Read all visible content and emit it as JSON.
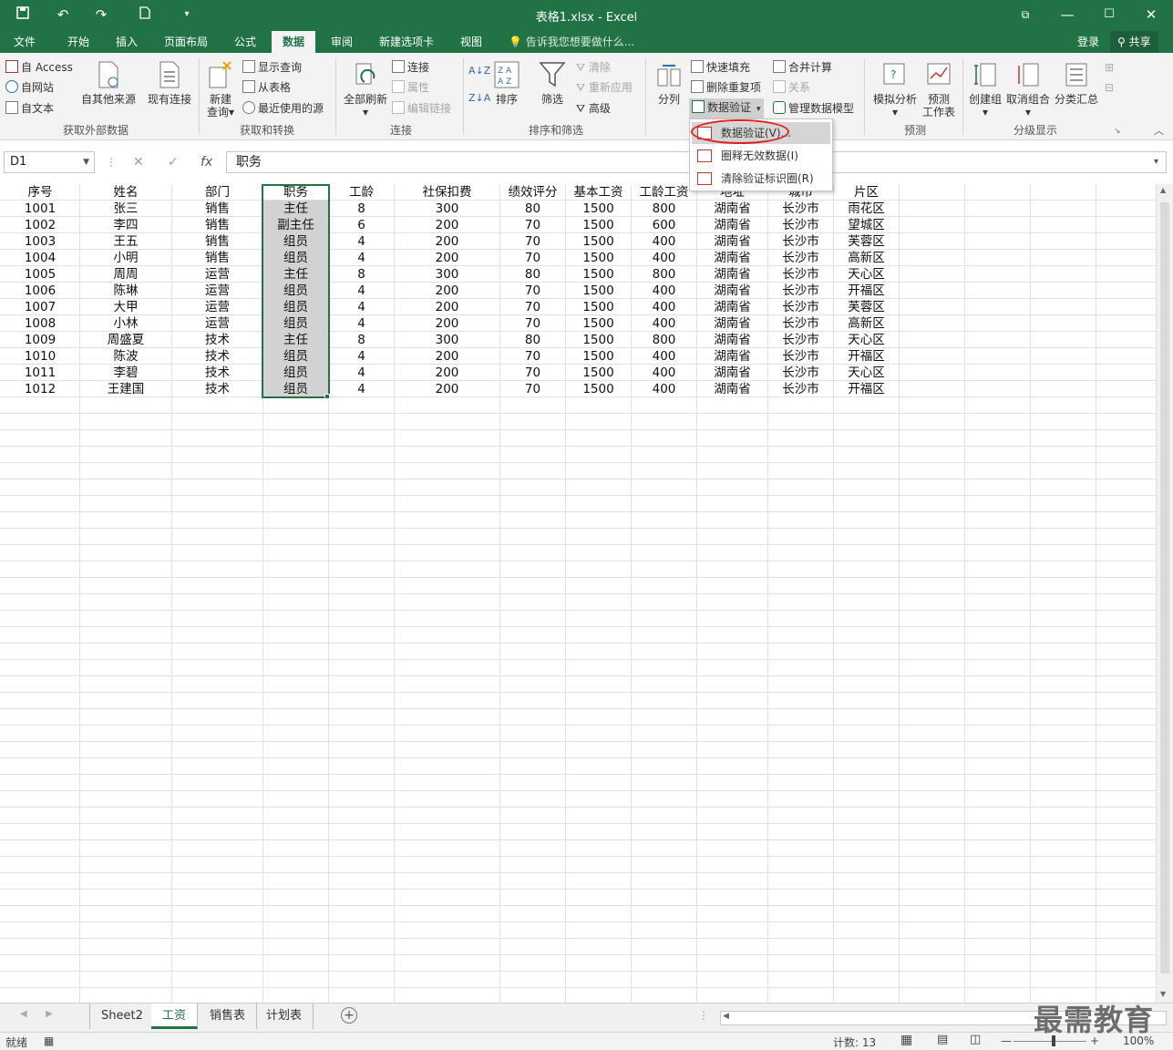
{
  "window": {
    "title": "表格1.xlsx - Excel",
    "qat": [
      "save-icon",
      "undo-icon",
      "redo-icon",
      "new-file-icon",
      "customize-qat-icon"
    ],
    "controls": [
      "ribbon-display-icon",
      "minimize-icon",
      "maximize-icon",
      "close-icon"
    ]
  },
  "tabs": [
    "文件",
    "开始",
    "插入",
    "页面布局",
    "公式",
    "数据",
    "审阅",
    "新建选项卡",
    "视图"
  ],
  "active_tab": "数据",
  "tell_me": "告诉我您想要做什么...",
  "signin": "登录",
  "share": "共享",
  "ribbon": {
    "get_external": {
      "group": "获取外部数据",
      "from_access": "自 Access",
      "from_web": "自网站",
      "from_text": "自文本",
      "from_other": "自其他来源",
      "existing": "现有连接"
    },
    "get_transform": {
      "group": "获取和转换",
      "new_query_1": "新建",
      "new_query_2": "查询",
      "show_queries": "显示查询",
      "from_table": "从表格",
      "recent_sources": "最近使用的源"
    },
    "connections": {
      "group": "连接",
      "refresh_all": "全部刷新",
      "connections": "连接",
      "properties": "属性",
      "edit_links": "编辑链接"
    },
    "sort_filter": {
      "group": "排序和筛选",
      "sort": "排序",
      "filter": "筛选",
      "clear": "清除",
      "reapply": "重新应用",
      "advanced": "高级"
    },
    "data_tools": {
      "split": "分列",
      "flash_fill": "快速填充",
      "remove_dup": "删除重复项",
      "validation": "数据验证",
      "consolidate": "合并计算",
      "relationships": "关系",
      "manage_model": "管理数据模型"
    },
    "forecast": {
      "group": "预测",
      "what_if": "模拟分析",
      "sheet_1": "预测",
      "sheet_2": "工作表"
    },
    "outline": {
      "group": "分级显示",
      "group_btn": "创建组",
      "ungroup": "取消组合",
      "subtotal": "分类汇总"
    }
  },
  "validation_menu": [
    {
      "label": "数据验证(V)..."
    },
    {
      "label": "圈释无效数据(I)"
    },
    {
      "label": "清除验证标识圈(R)"
    }
  ],
  "formula_bar": {
    "name_box": "D1",
    "cancel": "✕",
    "enter": "✓",
    "fx": "fx",
    "value": "职务"
  },
  "sheet": {
    "headers": [
      "序号",
      "姓名",
      "部门",
      "职务",
      "工龄",
      "社保扣费",
      "绩效评分",
      "基本工资",
      "工龄工资",
      "地址",
      "城市",
      "片区"
    ],
    "rows": [
      [
        "1001",
        "张三",
        "销售",
        "主任",
        "8",
        "300",
        "80",
        "1500",
        "800",
        "湖南省",
        "长沙市",
        "雨花区"
      ],
      [
        "1002",
        "李四",
        "销售",
        "副主任",
        "6",
        "200",
        "70",
        "1500",
        "600",
        "湖南省",
        "长沙市",
        "望城区"
      ],
      [
        "1003",
        "王五",
        "销售",
        "组员",
        "4",
        "200",
        "70",
        "1500",
        "400",
        "湖南省",
        "长沙市",
        "芙蓉区"
      ],
      [
        "1004",
        "小明",
        "销售",
        "组员",
        "4",
        "200",
        "70",
        "1500",
        "400",
        "湖南省",
        "长沙市",
        "高新区"
      ],
      [
        "1005",
        "周周",
        "运营",
        "主任",
        "8",
        "300",
        "80",
        "1500",
        "800",
        "湖南省",
        "长沙市",
        "天心区"
      ],
      [
        "1006",
        "陈琳",
        "运营",
        "组员",
        "4",
        "200",
        "70",
        "1500",
        "400",
        "湖南省",
        "长沙市",
        "开福区"
      ],
      [
        "1007",
        "大甲",
        "运营",
        "组员",
        "4",
        "200",
        "70",
        "1500",
        "400",
        "湖南省",
        "长沙市",
        "芙蓉区"
      ],
      [
        "1008",
        "小林",
        "运营",
        "组员",
        "4",
        "200",
        "70",
        "1500",
        "400",
        "湖南省",
        "长沙市",
        "高新区"
      ],
      [
        "1009",
        "周盛夏",
        "技术",
        "主任",
        "8",
        "300",
        "80",
        "1500",
        "800",
        "湖南省",
        "长沙市",
        "天心区"
      ],
      [
        "1010",
        "陈波",
        "技术",
        "组员",
        "4",
        "200",
        "70",
        "1500",
        "400",
        "湖南省",
        "长沙市",
        "开福区"
      ],
      [
        "1011",
        "李碧",
        "技术",
        "组员",
        "4",
        "200",
        "70",
        "1500",
        "400",
        "湖南省",
        "长沙市",
        "天心区"
      ],
      [
        "1012",
        "王建国",
        "技术",
        "组员",
        "4",
        "200",
        "70",
        "1500",
        "400",
        "湖南省",
        "长沙市",
        "开福区"
      ]
    ]
  },
  "sheet_tabs": [
    "Sheet2",
    "工资",
    "销售表",
    "计划表"
  ],
  "active_sheet": "工资",
  "status": {
    "ready": "就绪",
    "count": "计数: 13",
    "zoom": "100%"
  },
  "watermark": "最需教育",
  "colors": {
    "accent": "#217346",
    "selection": "#d2d2d2",
    "highlight_ring": "#e02020"
  }
}
